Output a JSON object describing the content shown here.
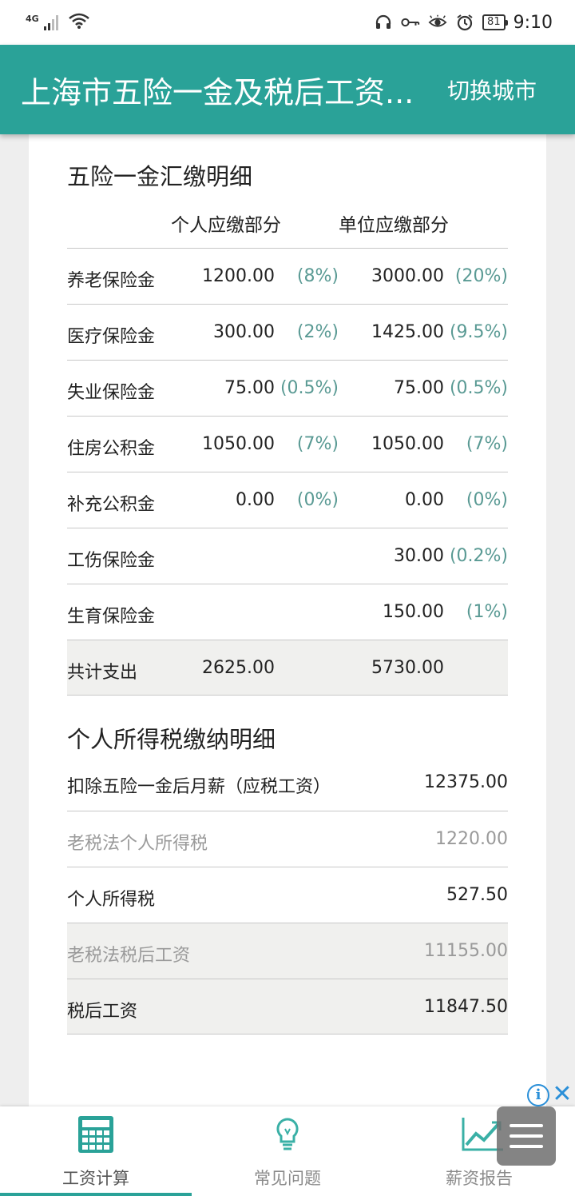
{
  "status_bar": {
    "network": "4G",
    "battery": "81",
    "time": "9:10",
    "icons": [
      "headset-icon",
      "key-icon",
      "eye-icon",
      "alarm-icon"
    ]
  },
  "app_bar": {
    "title": "上海市五险一金及税后工资...",
    "action": "切换城市",
    "color": "#2aa298"
  },
  "insurance": {
    "title": "五险一金汇缴明细",
    "personal_header": "个人应缴部分",
    "company_header": "单位应缴部分",
    "rows": [
      {
        "name": "养老保险金",
        "personal_value": "1200.00",
        "personal_rate": "(8%)",
        "company_value": "3000.00",
        "company_rate": "(20%)"
      },
      {
        "name": "医疗保险金",
        "personal_value": "300.00",
        "personal_rate": "(2%)",
        "company_value": "1425.00",
        "company_rate": "(9.5%)"
      },
      {
        "name": "失业保险金",
        "personal_value": "75.00",
        "personal_rate": "(0.5%)",
        "company_value": "75.00",
        "company_rate": "(0.5%)"
      },
      {
        "name": "住房公积金",
        "personal_value": "1050.00",
        "personal_rate": "(7%)",
        "company_value": "1050.00",
        "company_rate": "(7%)"
      },
      {
        "name": "补充公积金",
        "personal_value": "0.00",
        "personal_rate": "(0%)",
        "company_value": "0.00",
        "company_rate": "(0%)"
      },
      {
        "name": "工伤保险金",
        "personal_value": "",
        "personal_rate": "",
        "company_value": "30.00",
        "company_rate": "(0.2%)"
      },
      {
        "name": "生育保险金",
        "personal_value": "",
        "personal_rate": "",
        "company_value": "150.00",
        "company_rate": "(1%)"
      }
    ],
    "total": {
      "name": "共计支出",
      "personal_value": "2625.00",
      "company_value": "5730.00"
    }
  },
  "tax": {
    "title": "个人所得税缴纳明细",
    "rows": [
      {
        "label": "扣除五险一金后月薪（应税工资）",
        "value": "12375.00"
      },
      {
        "label": "老税法个人所得税",
        "value": "1220.00"
      },
      {
        "label": "个人所得税",
        "value": "527.50"
      },
      {
        "label": "老税法税后工资",
        "value": "11155.00"
      },
      {
        "label": "税后工资",
        "value": "11847.50"
      }
    ]
  },
  "ad": {
    "info": "i",
    "close": "✕"
  },
  "bottom_nav": [
    {
      "label": "工资计算",
      "icon": "calculator-icon",
      "active": true
    },
    {
      "label": "常见问题",
      "icon": "lightbulb-icon",
      "active": false
    },
    {
      "label": "薪资报告",
      "icon": "chart-icon",
      "active": false
    }
  ]
}
